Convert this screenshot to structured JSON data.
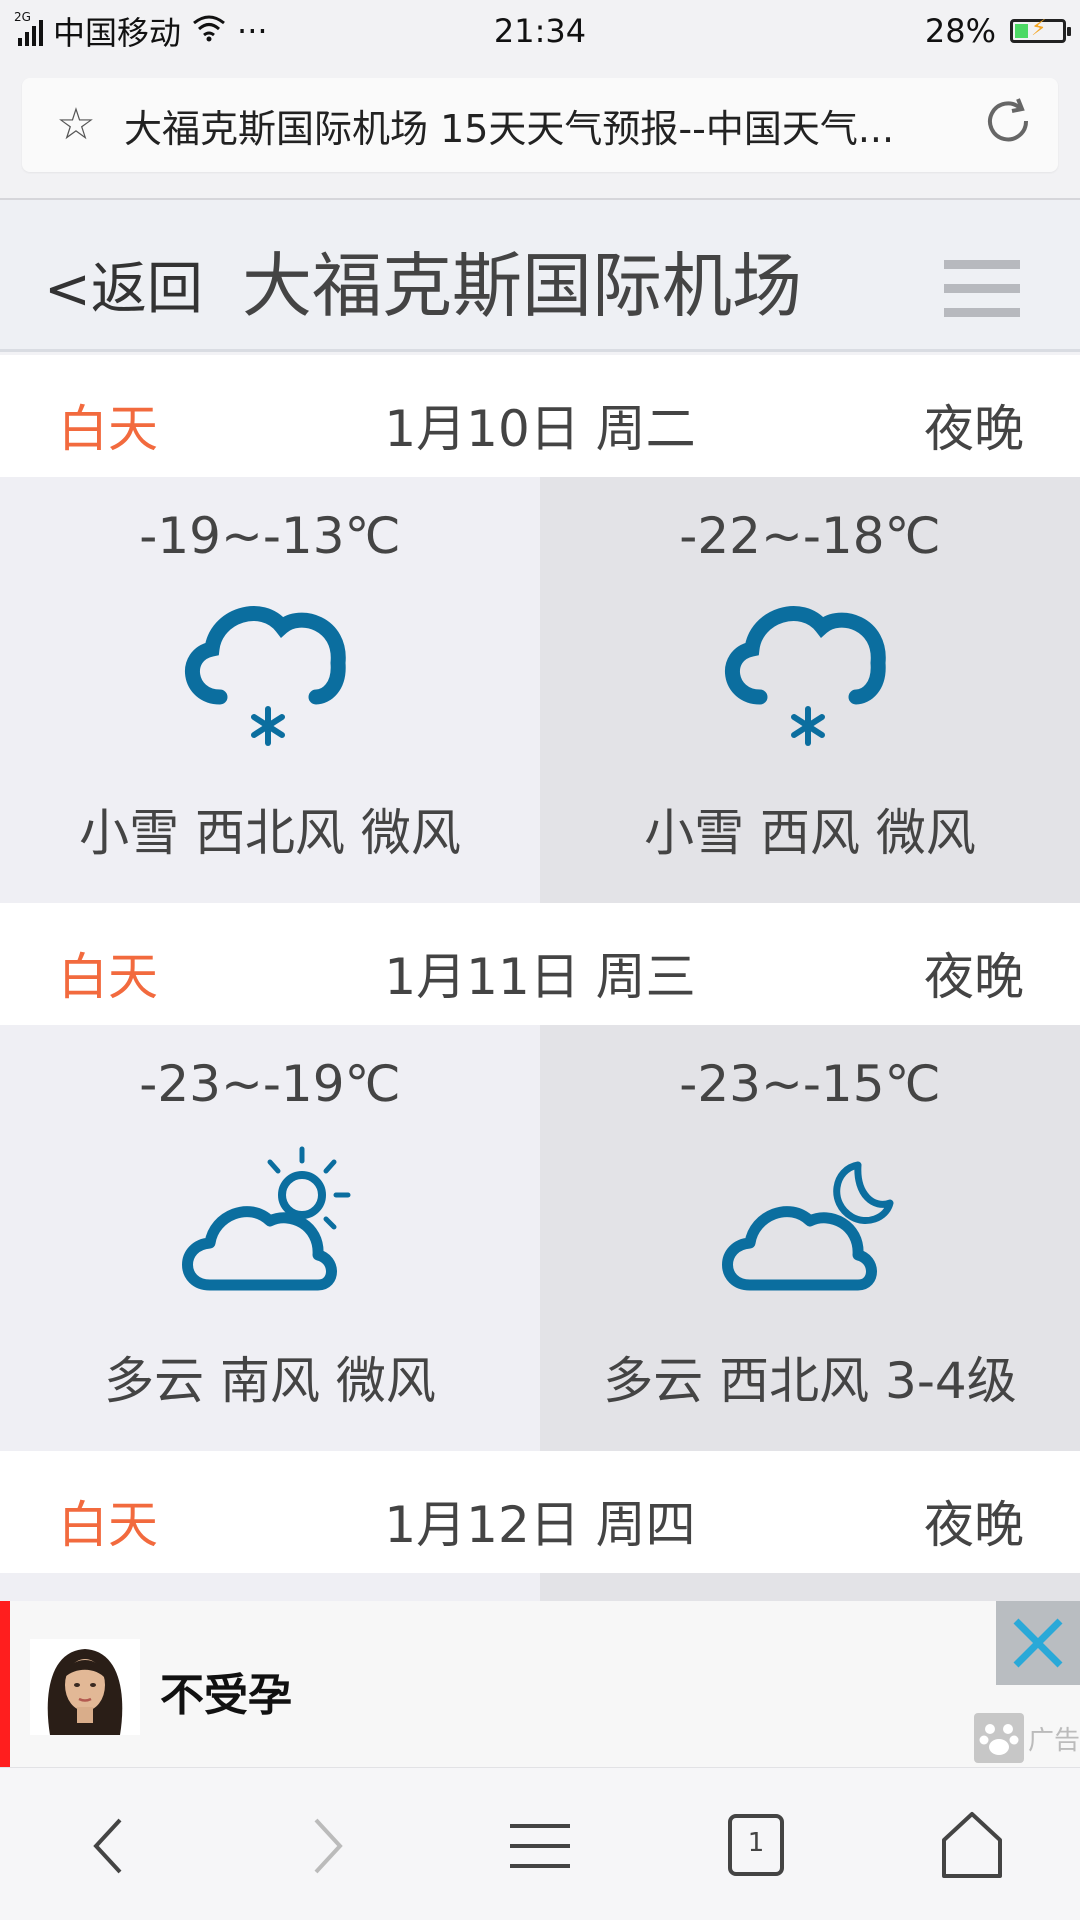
{
  "status_bar": {
    "network": "2G",
    "carrier": "中国移动",
    "more": "···",
    "time": "21:34",
    "battery": "28%",
    "battery_level": 0.28
  },
  "url_bar": {
    "title": "大福克斯国际机场 15天天气预报--中国天气..."
  },
  "header": {
    "back_label": "<返回",
    "title": "大福克斯国际机场"
  },
  "forecast": {
    "day_label": "白天",
    "night_label": "夜晚",
    "days": [
      {
        "date": "1月10日 周二",
        "day": {
          "temp": "-19~-13℃",
          "icon": "light-snow-icon",
          "desc": "小雪 西北风 微风"
        },
        "night": {
          "temp": "-22~-18℃",
          "icon": "light-snow-icon",
          "desc": "小雪 西风 微风"
        }
      },
      {
        "date": "1月11日 周三",
        "day": {
          "temp": "-23~-19℃",
          "icon": "partly-cloudy-day-icon",
          "desc": "多云 南风 微风"
        },
        "night": {
          "temp": "-23~-15℃",
          "icon": "partly-cloudy-night-icon",
          "desc": "多云 西北风 3-4级"
        }
      },
      {
        "date": "1月12日 周四"
      }
    ]
  },
  "ad": {
    "text": "不受孕",
    "mark": "广告"
  },
  "toolbar": {
    "tab_count": "1"
  },
  "colors": {
    "accent_day": "#f26a3e",
    "icon_blue": "#0b6e9f",
    "ad_red": "#ff1e1e",
    "close_blue": "#2aa9d8"
  }
}
